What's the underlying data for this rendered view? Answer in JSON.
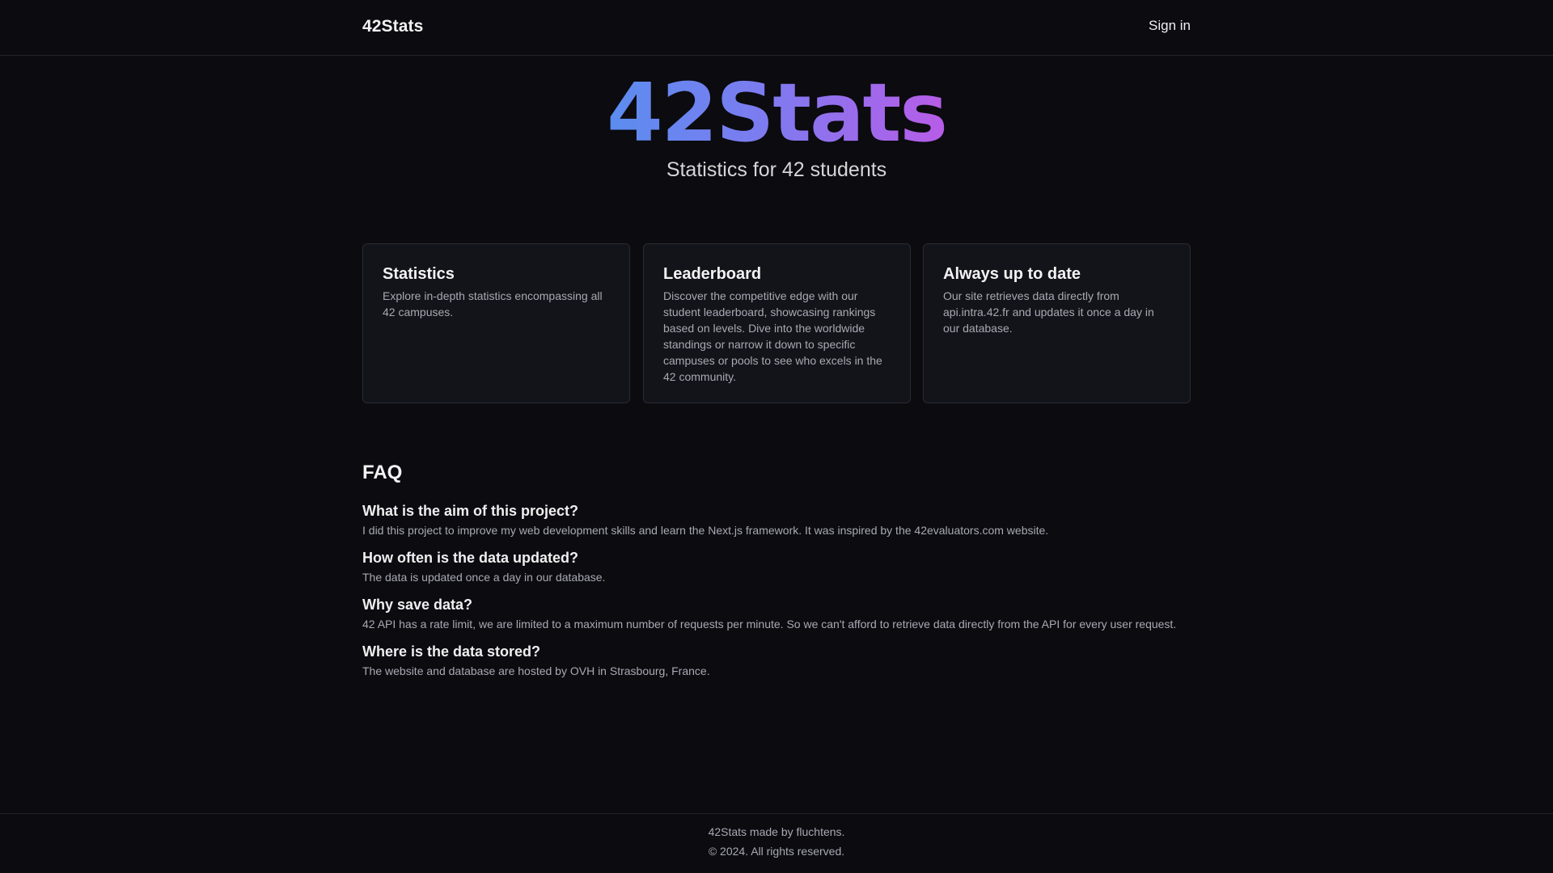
{
  "header": {
    "brand": "42Stats",
    "sign_in": "Sign in"
  },
  "hero": {
    "title": "42Stats",
    "subtitle": "Statistics for 42 students",
    "gradient": [
      "#5b8def",
      "#b85ce8"
    ]
  },
  "cards": [
    {
      "title": "Statistics",
      "text": "Explore in-depth statistics encompassing all 42 campuses."
    },
    {
      "title": "Leaderboard",
      "text": "Discover the competitive edge with our student leaderboard, showcasing rankings based on levels. Dive into the worldwide standings or narrow it down to specific campuses or pools to see who excels in the 42 community."
    },
    {
      "title": "Always up to date",
      "text": "Our site retrieves data directly from api.intra.42.fr and updates it once a day in our database."
    }
  ],
  "faq": {
    "title": "FAQ",
    "items": [
      {
        "q": "What is the aim of this project?",
        "a": "I did this project to improve my web development skills and learn the Next.js framework. It was inspired by the 42evaluators.com website."
      },
      {
        "q": "How often is the data updated?",
        "a": "The data is updated once a day in our database."
      },
      {
        "q": "Why save data?",
        "a": "42 API has a rate limit, we are limited to a maximum number of requests per minute. So we can't afford to retrieve data directly from the API for every user request."
      },
      {
        "q": "Where is the data stored?",
        "a": "The website and database are hosted by OVH in Strasbourg, France."
      }
    ]
  },
  "footer": {
    "made_by": "42Stats made by fluchtens.",
    "copyright": "© 2024. All rights reserved."
  }
}
